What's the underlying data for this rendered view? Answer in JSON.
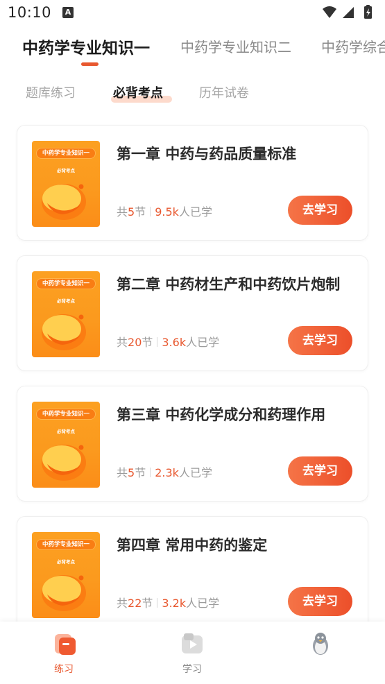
{
  "status_bar": {
    "time": "10:10",
    "a_badge": "A"
  },
  "top_tabs": [
    {
      "label": "中药学专业知识一",
      "active": true
    },
    {
      "label": "中药学专业知识二",
      "active": false
    },
    {
      "label": "中药学综合",
      "active": false
    }
  ],
  "sub_tabs": [
    {
      "label": "题库练习",
      "active": false
    },
    {
      "label": "必背考点",
      "active": true
    },
    {
      "label": "历年试卷",
      "active": false
    }
  ],
  "cover": {
    "title": "中药学专业知识一",
    "subtitle": "必背考点"
  },
  "chapters": [
    {
      "title": "第一章  中药与药品质量标准",
      "meta_prefix": "共",
      "sections": "5",
      "meta_unit": "节",
      "learners": "9.5k",
      "learners_suffix": "人已学",
      "button": "去学习"
    },
    {
      "title": "第二章  中药材生产和中药饮片炮制",
      "meta_prefix": "共",
      "sections": "20",
      "meta_unit": "节",
      "learners": "3.6k",
      "learners_suffix": "人已学",
      "button": "去学习"
    },
    {
      "title": "第三章  中药化学成分和药理作用",
      "meta_prefix": "共",
      "sections": "5",
      "meta_unit": "节",
      "learners": "2.3k",
      "learners_suffix": "人已学",
      "button": "去学习"
    },
    {
      "title": "第四章  常用中药的鉴定",
      "meta_prefix": "共",
      "sections": "22",
      "meta_unit": "节",
      "learners": "3.2k",
      "learners_suffix": "人已学",
      "button": "去学习"
    }
  ],
  "bottom_nav": [
    {
      "label": "练习",
      "icon": "practice-icon",
      "active": true
    },
    {
      "label": "学习",
      "icon": "video-play-icon",
      "active": false
    },
    {
      "label": "",
      "icon": "penguin-avatar-icon",
      "active": false
    }
  ],
  "colors": {
    "accent": "#e8582f",
    "cover": "#fb9a1e",
    "button_start": "#f57447",
    "button_end": "#ec4f2a"
  }
}
